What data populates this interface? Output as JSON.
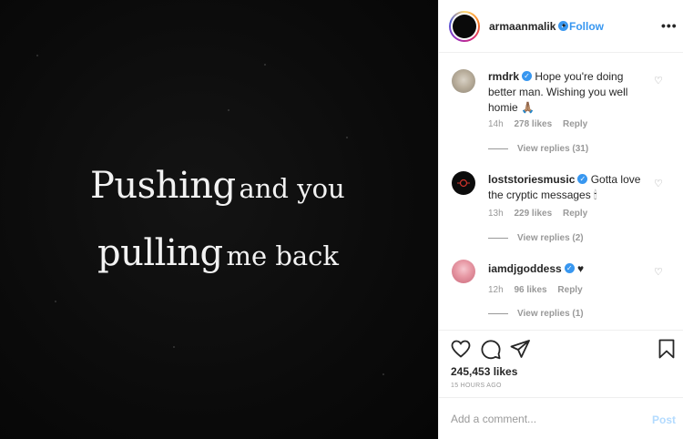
{
  "post_image": {
    "line1_big": "Pushing",
    "line1_small": "and you",
    "line2_big": "pulling",
    "line2_small": "me back"
  },
  "header": {
    "username": "armaanmalik",
    "separator": "•",
    "follow_label": "Follow",
    "more_label": "•••"
  },
  "comments": [
    {
      "username": "rmdrk",
      "text": "Hope you're doing better man. Wishing you well homie 🙏🏽",
      "time": "14h",
      "likes": "278 likes",
      "reply_label": "Reply",
      "view_replies": "View replies (31)"
    },
    {
      "username": "loststoriesmusic",
      "text": "Gotta love the cryptic messages 🕯",
      "time": "13h",
      "likes": "229 likes",
      "reply_label": "Reply",
      "view_replies": "View replies (2)"
    },
    {
      "username": "iamdjgoddess",
      "text": "♥",
      "time": "12h",
      "likes": "96 likes",
      "reply_label": "Reply",
      "view_replies": "View replies (1)"
    }
  ],
  "actions": {
    "likes_count": "245,453 likes",
    "time_ago": "15 HOURS AGO"
  },
  "add_comment": {
    "placeholder": "Add a comment...",
    "post_label": "Post"
  },
  "colors": {
    "accent": "#3897f0",
    "post_disabled": "#b3dbff",
    "muted": "#999999"
  },
  "icons": [
    "heart-icon",
    "comment-icon",
    "share-icon",
    "bookmark-icon",
    "verified-icon",
    "more-icon"
  ]
}
